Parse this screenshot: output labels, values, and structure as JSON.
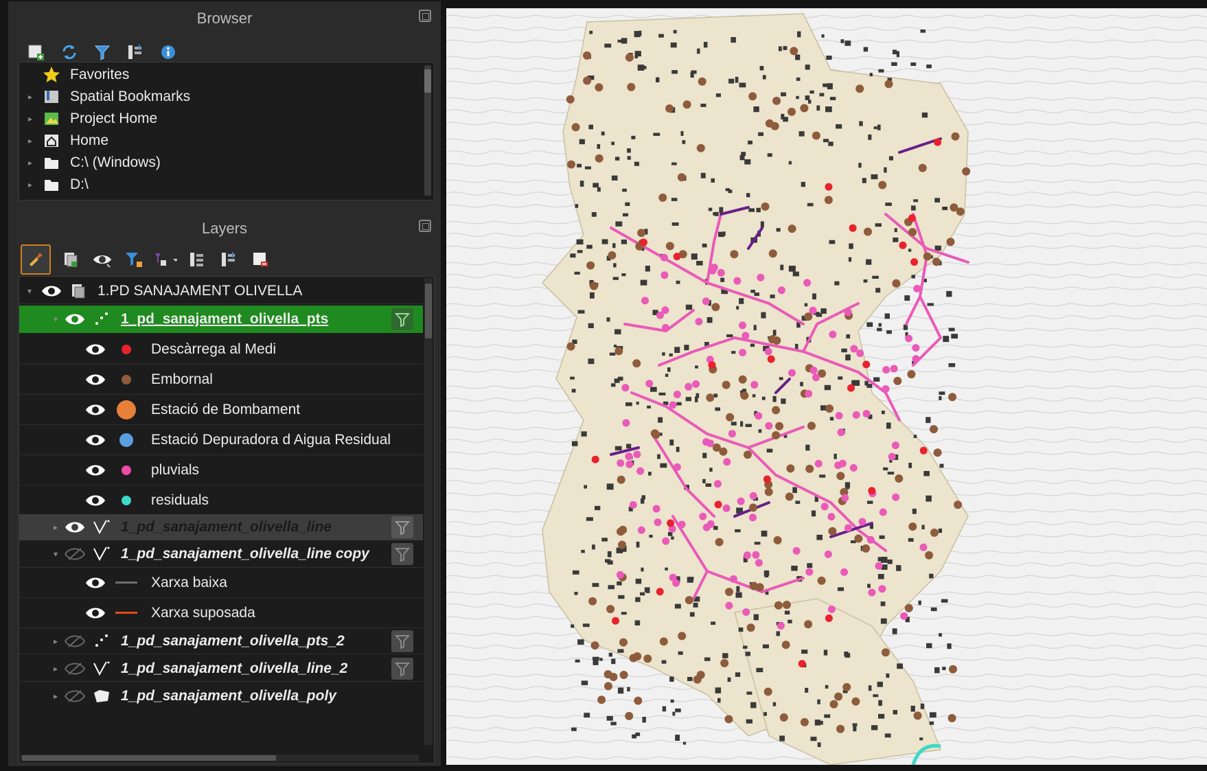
{
  "browser": {
    "title": "Browser",
    "toolbar": [
      "add-layer-icon",
      "refresh-icon",
      "filter-icon",
      "collapse-all-icon",
      "info-icon"
    ],
    "items": [
      {
        "label": "Favorites",
        "icon": "star-icon",
        "expandable": false
      },
      {
        "label": "Spatial Bookmarks",
        "icon": "bookmark-icon",
        "expandable": true
      },
      {
        "label": "Project Home",
        "icon": "project-home-icon",
        "expandable": true
      },
      {
        "label": "Home",
        "icon": "home-icon",
        "expandable": true
      },
      {
        "label": "C:\\ (Windows)",
        "icon": "folder-icon",
        "expandable": true
      },
      {
        "label": "D:\\",
        "icon": "folder-icon",
        "expandable": true
      }
    ]
  },
  "layers": {
    "title": "Layers",
    "toolbar": [
      "style-panel-icon",
      "add-group-icon",
      "manage-visibility-icon",
      "filter-legend-icon",
      "filter-expression-icon",
      "expand-all-icon",
      "collapse-all-icon",
      "remove-layer-icon"
    ],
    "group": {
      "label": "1.PD SANAJAMENT OLIVELLA"
    },
    "pts_layer": {
      "label": "1_pd_sanajament_olivella_pts"
    },
    "pts_classes": [
      {
        "label": "Descàrrega al Medi",
        "color": "#e8222e",
        "size": 14
      },
      {
        "label": "Embornal",
        "color": "#8e5c3c",
        "size": 14
      },
      {
        "label": "Estació de Bombament",
        "color": "#e8803a",
        "size": 28
      },
      {
        "label": "Estació Depuradora d Aigua Residual",
        "color": "#5b9ee0",
        "size": 20
      },
      {
        "label": "pluvials",
        "color": "#f04aa8",
        "size": 14
      },
      {
        "label": "residuals",
        "color": "#3ed8c6",
        "size": 14
      }
    ],
    "line_layer": {
      "label": "1_pd_sanajament_olivella_line"
    },
    "line_copy_layer": {
      "label": "1_pd_sanajament_olivella_line copy"
    },
    "line_classes": [
      {
        "label": "Xarxa baixa",
        "color": "#6e6e6e"
      },
      {
        "label": "Xarxa suposada",
        "color": "#e84a1c"
      }
    ],
    "pts2_layer": {
      "label": "1_pd_sanajament_olivella_pts_2"
    },
    "line2_layer": {
      "label": "1_pd_sanajament_olivella_line_2"
    },
    "poly_layer": {
      "label": "1_pd_sanajament_olivella_poly"
    }
  },
  "map": {
    "background": "#f1f1f1",
    "urban_fill": "#ece4cc",
    "pluvial_color": "#ea5ab8",
    "residual_line_color": "#6a1f8a",
    "manhole_color": "#8e5c3c",
    "discharge_color": "#e8222e",
    "residual_color": "#3ed8c6"
  }
}
